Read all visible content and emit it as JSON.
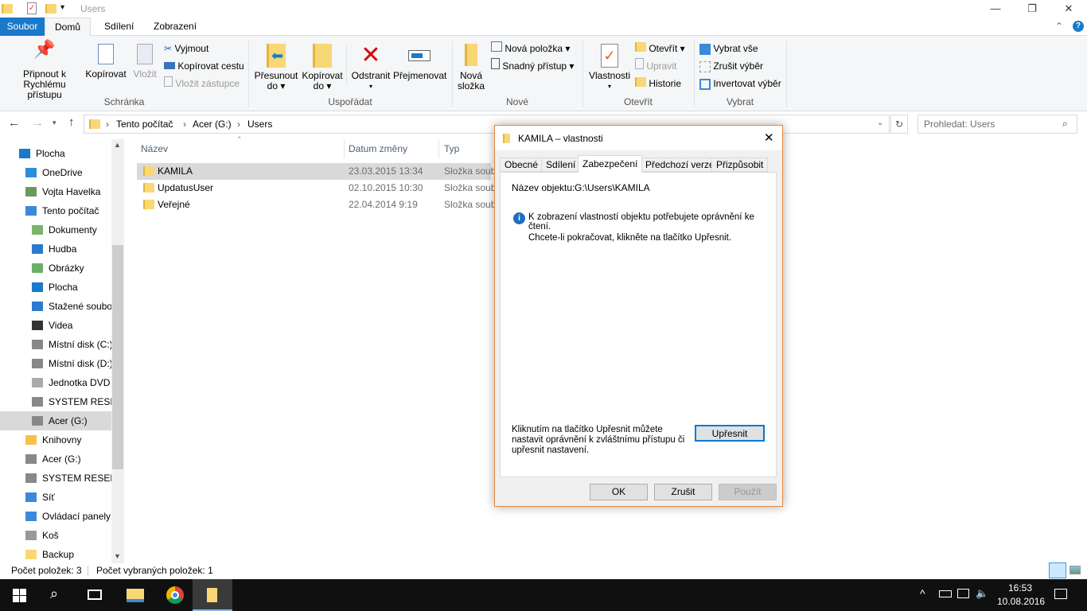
{
  "window": {
    "title": "Users",
    "min": "—",
    "max": "❐",
    "close": "✕"
  },
  "ribbon_tabs": {
    "file": "Soubor",
    "home": "Domů",
    "share": "Sdílení",
    "view": "Zobrazení",
    "help": "?",
    "collapse": "⌃"
  },
  "ribbon": {
    "clipboard": {
      "group": "Schránka",
      "pin": "Připnout k",
      "pin2": "Rychlému přístupu",
      "copy": "Kopírovat",
      "paste": "Vložit",
      "cut": "Vyjmout",
      "copy_path": "Kopírovat cestu",
      "paste_shortcut": "Vložit zástupce"
    },
    "organize": {
      "group": "Uspořádat",
      "move": "Přesunout",
      "move2": "do ▾",
      "copy_to": "Kopírovat",
      "copy_to2": "do ▾",
      "delete": "Odstranit",
      "delete2": "▾",
      "rename": "Přejmenovat"
    },
    "new": {
      "group": "Nové",
      "new_folder": "Nová",
      "new_folder2": "složka",
      "new_item": "Nová položka ▾",
      "easy_access": "Snadný přístup ▾"
    },
    "open": {
      "group": "Otevřít",
      "properties": "Vlastnosti",
      "properties2": "▾",
      "open": "Otevřít ▾",
      "edit": "Upravit",
      "history": "Historie"
    },
    "select": {
      "group": "Vybrat",
      "select_all": "Vybrat vše",
      "select_none": "Zrušit výběr",
      "invert": "Invertovat výběr"
    }
  },
  "address": {
    "crumbs": [
      "Tento počítač",
      "Acer (G:)",
      "Users"
    ],
    "search_placeholder": "Prohledat: Users"
  },
  "nav": [
    {
      "label": "Plocha"
    },
    {
      "label": "OneDrive"
    },
    {
      "label": "Vojta Havelka"
    },
    {
      "label": "Tento počítač"
    },
    {
      "label": "Dokumenty"
    },
    {
      "label": "Hudba"
    },
    {
      "label": "Obrázky"
    },
    {
      "label": "Plocha"
    },
    {
      "label": "Stažené soubory"
    },
    {
      "label": "Videa"
    },
    {
      "label": "Místní disk (C:)"
    },
    {
      "label": "Místní disk (D:)"
    },
    {
      "label": "Jednotka DVD RW"
    },
    {
      "label": "SYSTEM RESERVED"
    },
    {
      "label": "Acer (G:)"
    },
    {
      "label": "Knihovny"
    },
    {
      "label": "Acer (G:)"
    },
    {
      "label": "SYSTEM RESERVED"
    },
    {
      "label": "Síť"
    },
    {
      "label": "Ovládací panely"
    },
    {
      "label": "Koš"
    },
    {
      "label": "Backup"
    }
  ],
  "columns": {
    "name": "Název",
    "date": "Datum změny",
    "type": "Typ"
  },
  "files": [
    {
      "name": "KAMILA",
      "date": "23.03.2015 13:34",
      "type": "Složka souborů"
    },
    {
      "name": "UpdatusUser",
      "date": "02.10.2015 10:30",
      "type": "Složka souborů"
    },
    {
      "name": "Veřejné",
      "date": "22.04.2014 9:19",
      "type": "Složka souborů"
    }
  ],
  "status": {
    "count": "Počet položek: 3",
    "selected": "Počet vybraných položek: 1"
  },
  "dialog": {
    "title": "KAMILA – vlastnosti",
    "close": "✕",
    "tabs": [
      "Obecné",
      "Sdílení",
      "Zabezpečení",
      "Předchozí verze",
      "Přizpůsobit"
    ],
    "object_label": "Název objektu:",
    "object_value": "G:\\Users\\KAMILA",
    "info": "K zobrazení vlastností objektu potřebujete oprávnění ke čtení.",
    "continue": "Chcete-li pokračovat, klikněte na tlačítko Upřesnit.",
    "advanced_text": "Kliknutím na tlačítko Upřesnit můžete nastavit oprávnění k zvláštnímu přístupu či upřesnit nastavení.",
    "advanced": "Upřesnit",
    "ok": "OK",
    "cancel": "Zrušit",
    "apply": "Použít"
  },
  "taskbar": {
    "time": "16:53",
    "date": "10.08.2016"
  }
}
